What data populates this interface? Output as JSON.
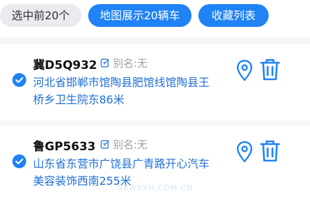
{
  "toolbar": {
    "select_top": "选中前20个",
    "show_on_map": "地图展示20辆车",
    "favorites": "收藏列表"
  },
  "vehicles": [
    {
      "plate": "冀D5Q932",
      "alias": "别名:无",
      "address": "河北省邯郸市馆陶县肥馆线馆陶县王桥乡卫生院东86米",
      "selected": true
    },
    {
      "plate": "鲁GP5633",
      "alias": "别名:无",
      "address": "山东省东营市广饶县广青路开心汽车美容装饰西南255米",
      "selected": true
    }
  ],
  "watermark": "N8WYXH.COM.CN",
  "colors": {
    "accent": "#1f82f5",
    "link": "#1f6fd6",
    "muted": "#9aa0a6"
  },
  "icons": {
    "check": "check-icon",
    "edit": "edit-icon",
    "location": "location-pin-icon",
    "delete": "trash-icon"
  }
}
